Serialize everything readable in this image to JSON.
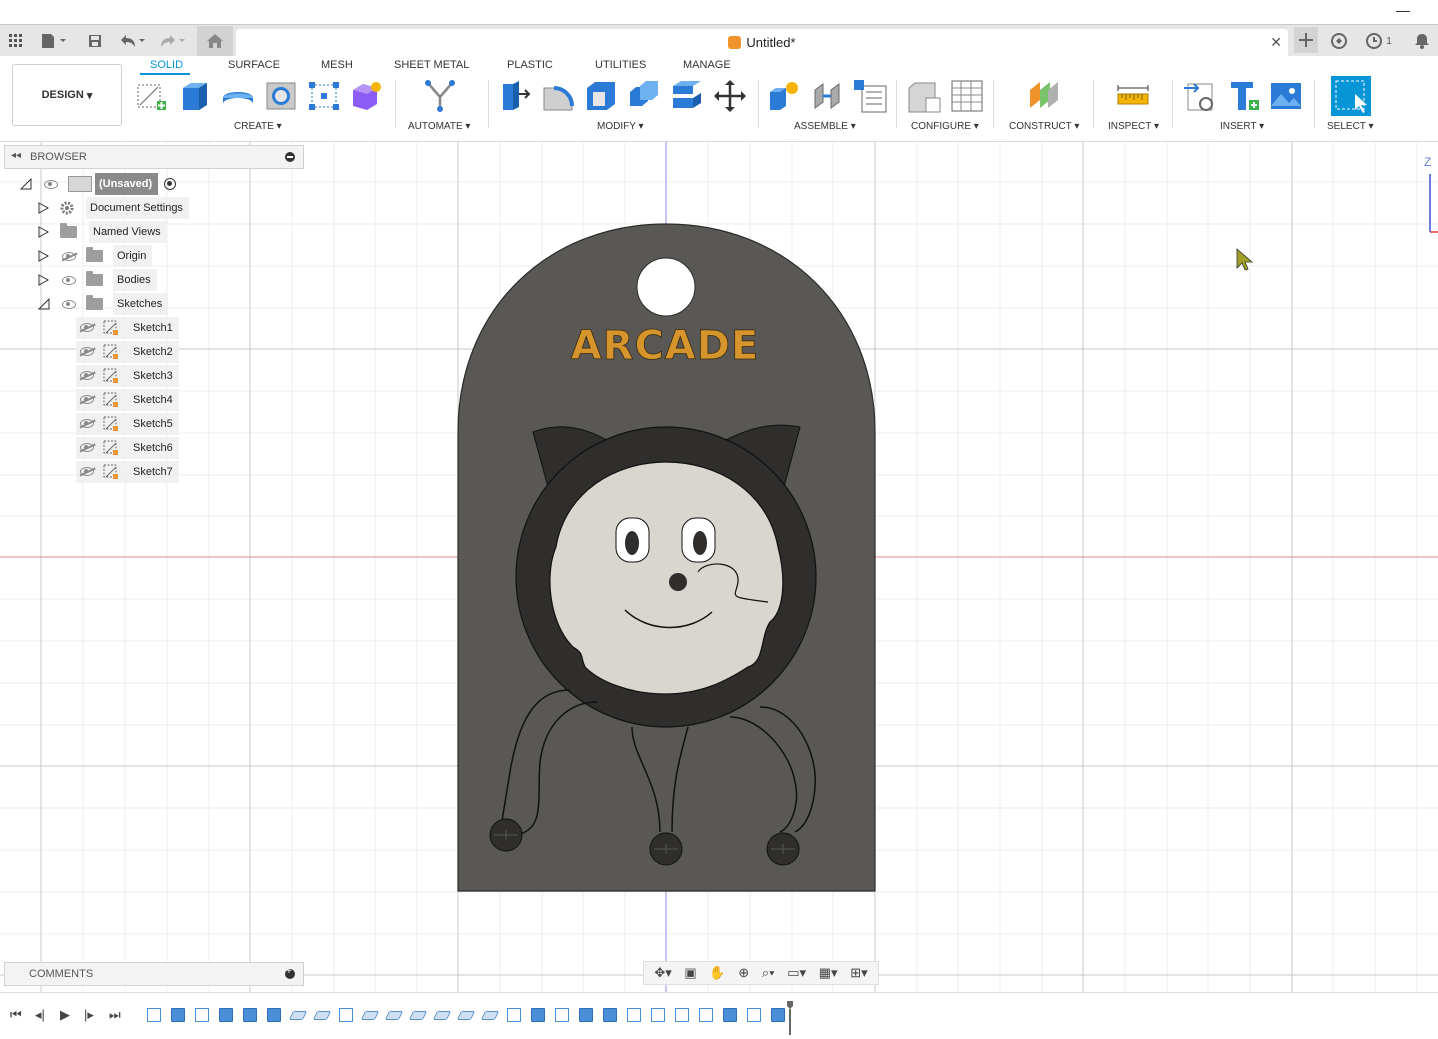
{
  "window": {
    "minimize_glyph": "—"
  },
  "topbar": {
    "doc_title": "Untitled*",
    "job_count": "1"
  },
  "ribbon": {
    "workspace": "DESIGN",
    "tabs": [
      "SOLID",
      "SURFACE",
      "MESH",
      "SHEET METAL",
      "PLASTIC",
      "UTILITIES",
      "MANAGE"
    ],
    "active_tab": "SOLID",
    "groups": [
      "CREATE",
      "AUTOMATE",
      "MODIFY",
      "ASSEMBLE",
      "CONFIGURE",
      "CONSTRUCT",
      "INSPECT",
      "INSERT",
      "SELECT"
    ]
  },
  "browser": {
    "title": "BROWSER",
    "root": "(Unsaved)",
    "items": [
      "Document Settings",
      "Named Views",
      "Origin",
      "Bodies",
      "Sketches"
    ],
    "sketches": [
      "Sketch1",
      "Sketch2",
      "Sketch3",
      "Sketch4",
      "Sketch5",
      "Sketch6",
      "Sketch7"
    ]
  },
  "comments": {
    "title": "COMMENTS"
  },
  "viewport": {
    "model_text": "ARCADE",
    "axis_label": "Z",
    "colors": {
      "body": "#5a5855",
      "text": "#d6952c",
      "face": "#d8d6cf",
      "ring": "#2f2e2d",
      "red_axis": "#e28a8a",
      "blue_axis": "#8d8de6",
      "accent": "#0696d7"
    }
  },
  "navbar": {
    "icons": [
      "orbit-icon",
      "look-at-icon",
      "pan-icon",
      "zoom-icon",
      "fit-icon",
      "display-settings-icon",
      "grid-settings-icon",
      "viewports-icon"
    ]
  },
  "timeline": {
    "controls": [
      "first-icon",
      "previous-icon",
      "play-icon",
      "next-icon",
      "last-icon"
    ],
    "features": [
      "sk",
      "ex",
      "sk",
      "ex",
      "ex",
      "ex",
      "pl",
      "pl",
      "sk",
      "pl",
      "pl",
      "pl",
      "pl",
      "pl",
      "pl",
      "sk",
      "ex",
      "sk",
      "ex",
      "ex",
      "fi",
      "fi",
      "fi",
      "sk",
      "ex",
      "sk",
      "ex"
    ]
  }
}
